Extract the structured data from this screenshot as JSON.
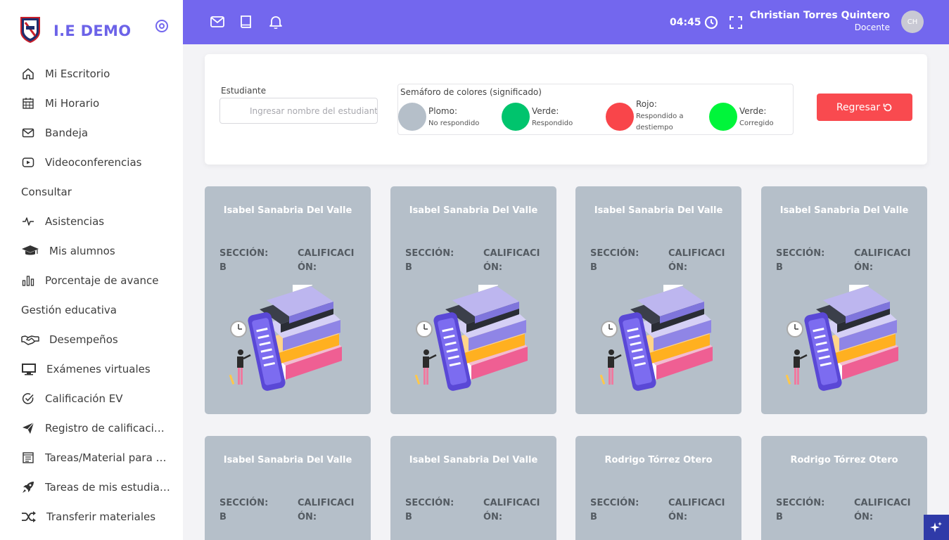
{
  "brand": {
    "name": "I.E DEMO"
  },
  "sidebar": {
    "items": [
      {
        "label": "Mi Escritorio",
        "icon": "home-icon"
      },
      {
        "label": "Mi Horario",
        "icon": "calendar-icon"
      },
      {
        "label": "Bandeja",
        "icon": "mail-icon"
      },
      {
        "label": "Videoconferencias",
        "icon": "video-icon"
      }
    ],
    "section1": "Consultar",
    "items2": [
      {
        "label": "Asistencias",
        "icon": "activity-icon"
      },
      {
        "label": "Mis alumnos",
        "icon": "graduation-cap-icon"
      },
      {
        "label": "Porcentaje de avance",
        "icon": "bar-chart-icon"
      }
    ],
    "section2": "Gestión educativa",
    "items3": [
      {
        "label": "Desempeños",
        "icon": "handshake-icon"
      },
      {
        "label": "Exámenes virtuales",
        "icon": "monitor-icon"
      },
      {
        "label": "Calificación EV",
        "icon": "check-circle-icon"
      },
      {
        "label": "Registro de calificaciones",
        "icon": "paper-plane-icon"
      },
      {
        "label": "Tareas/Material para alumnos",
        "icon": "clipboard-icon"
      },
      {
        "label": "Tareas de mis estudiantes",
        "icon": "rocket-icon"
      },
      {
        "label": "Transferir materiales",
        "icon": "shuffle-icon"
      }
    ]
  },
  "topbar": {
    "time": "04:45",
    "user_name": "Christian Torres Quintero",
    "user_role": "Docente",
    "avatar_initials": "CH"
  },
  "filter": {
    "student_label": "Estudiante",
    "student_placeholder": "Ingresar nombre del estudiante",
    "legend_title": "Semáforo de colores (significado)",
    "legend": [
      {
        "title": "Plomo:",
        "desc": "No respondido",
        "color": "#b5bfc9"
      },
      {
        "title": "Verde:",
        "desc": "Respondido",
        "color": "#00c46d"
      },
      {
        "title": "Rojo:",
        "desc": "Respondido a destiempo",
        "color": "#f9454a"
      },
      {
        "title": "Verde:",
        "desc": "Corregido",
        "color": "#00f53a"
      }
    ],
    "back_label": "Regresar"
  },
  "cards": [
    {
      "name": "Isabel Sanabria Del Valle",
      "section_label": "SECCIÓN:",
      "section_value": "B",
      "grade_label": "CALIFICACIÓN:"
    },
    {
      "name": "Isabel Sanabria Del Valle",
      "section_label": "SECCIÓN:",
      "section_value": "B",
      "grade_label": "CALIFICACIÓN:"
    },
    {
      "name": "Isabel Sanabria Del Valle",
      "section_label": "SECCIÓN:",
      "section_value": "B",
      "grade_label": "CALIFICACIÓN:"
    },
    {
      "name": "Isabel Sanabria Del Valle",
      "section_label": "SECCIÓN:",
      "section_value": "B",
      "grade_label": "CALIFICACIÓN:"
    },
    {
      "name": "Isabel Sanabria Del Valle",
      "section_label": "SECCIÓN:",
      "section_value": "B",
      "grade_label": "CALIFICACIÓN:"
    },
    {
      "name": "Isabel Sanabria Del Valle",
      "section_label": "SECCIÓN:",
      "section_value": "B",
      "grade_label": "CALIFICACIÓN:"
    },
    {
      "name": "Rodrigo Tórrez Otero",
      "section_label": "SECCIÓN:",
      "section_value": "B",
      "grade_label": "CALIFICACIÓN:"
    },
    {
      "name": "Rodrigo Tórrez Otero",
      "section_label": "SECCIÓN:",
      "section_value": "B",
      "grade_label": "CALIFICACIÓN:"
    }
  ],
  "colors": {
    "accent": "#7367ee",
    "danger": "#f94a4f",
    "card_bg": "#b5bfc9"
  }
}
